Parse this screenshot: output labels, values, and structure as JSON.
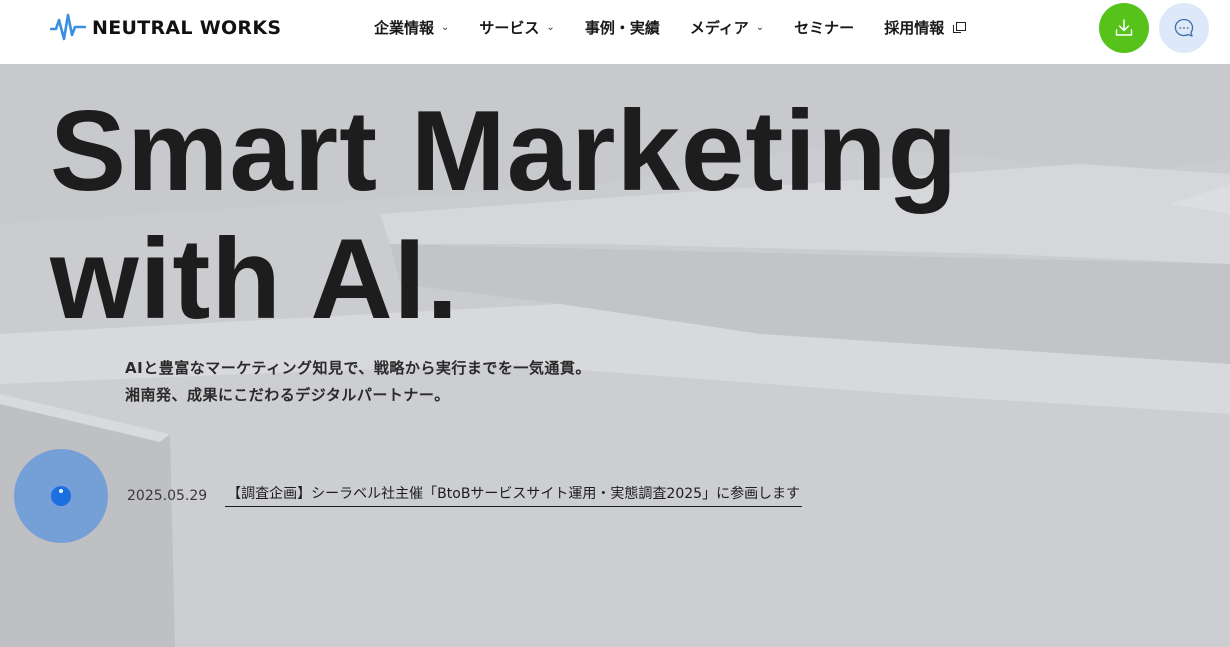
{
  "brand": {
    "name": "NEUTRAL WORKS",
    "accent": "#3b8fe0"
  },
  "nav": {
    "items": [
      {
        "label": "企業情報",
        "has_dropdown": true
      },
      {
        "label": "サービス",
        "has_dropdown": true
      },
      {
        "label": "事例・実績",
        "has_dropdown": false
      },
      {
        "label": "メディア",
        "has_dropdown": true
      },
      {
        "label": "セミナー",
        "has_dropdown": false
      },
      {
        "label": "採用情報",
        "external": true
      }
    ]
  },
  "actions": {
    "download_icon": "download-icon",
    "download_color": "#56c21a",
    "chat_icon": "chat-bubble-icon",
    "chat_color": "#dde9f8"
  },
  "hero": {
    "headline_line1": "Smart Marketing",
    "headline_line2": "with AI.",
    "tagline_line1": "AIと豊富なマーケティング知見で、戦略から実行までを一気通貫。",
    "tagline_line2": "湘南発、成果にこだわるデジタルパートナー。"
  },
  "news": {
    "date": "2025.05.29",
    "title": "【調査企画】シーラベル社主催「BtoBサービスサイト運用・実態調査2025」に参画します"
  }
}
